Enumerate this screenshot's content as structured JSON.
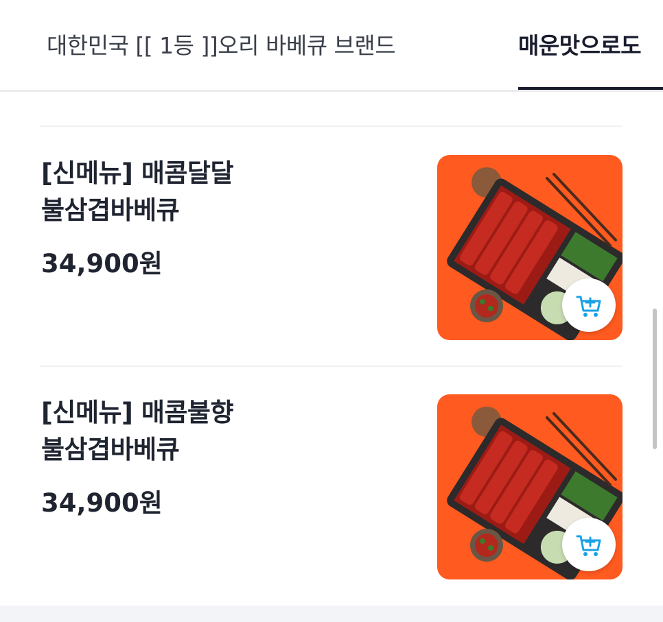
{
  "tabs": [
    {
      "label": "대한민국 [[ 1등 ]]오리 바베큐 브랜드",
      "active": false
    },
    {
      "label": "매운맛으로도",
      "active": true
    }
  ],
  "menu_items": [
    {
      "name_line1": "[신메뉴] 매콤달달",
      "name_line2": "불삼겹바베큐",
      "price": "34,900원"
    },
    {
      "name_line1": "[신메뉴] 매콤불향",
      "name_line2": "불삼겹바베큐",
      "price": "34,900원"
    }
  ],
  "icons": {
    "cart_add": "cart-plus-icon",
    "product_image": "food-thumbnail"
  },
  "colors": {
    "active_tab": "#171b2c",
    "cart_icon": "#19a1e6",
    "thumbnail_bg": "#ff5a1f"
  }
}
